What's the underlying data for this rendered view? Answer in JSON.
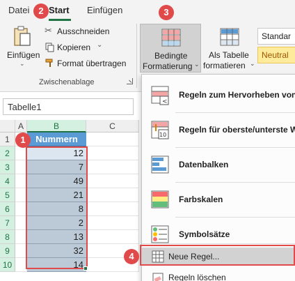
{
  "tabs": {
    "datei": "Datei",
    "start": "Start",
    "einfuegen": "Einfügen"
  },
  "ribbon": {
    "paste_label": "Einfügen",
    "cut_label": "Ausschneiden",
    "copy_label": "Kopieren",
    "format_painter_label": "Format übertragen",
    "clipboard_group_label": "Zwischenablage",
    "cond_format_line1": "Bedingte",
    "cond_format_line2": "Formatierung",
    "as_table_line1": "Als Tabelle",
    "as_table_line2": "formatieren",
    "style_standard": "Standar",
    "style_neutral": "Neutral"
  },
  "namebox": {
    "value": "Tabelle1"
  },
  "grid": {
    "columns": [
      "A",
      "B",
      "C"
    ],
    "header_row": "1",
    "header_cell": "Nummern",
    "rows": [
      {
        "row": "2",
        "value": "12"
      },
      {
        "row": "3",
        "value": "7"
      },
      {
        "row": "4",
        "value": "49"
      },
      {
        "row": "5",
        "value": "21"
      },
      {
        "row": "6",
        "value": "8"
      },
      {
        "row": "7",
        "value": "2"
      },
      {
        "row": "8",
        "value": "13"
      },
      {
        "row": "9",
        "value": "32"
      },
      {
        "row": "10",
        "value": "14"
      }
    ]
  },
  "menu": {
    "items": [
      {
        "label": "Regeln zum Hervorheben von",
        "icon": "highlight-rules-icon"
      },
      {
        "label": "Regeln für oberste/unterste W",
        "icon": "top-bottom-rules-icon"
      },
      {
        "label": "Datenbalken",
        "icon": "data-bars-icon"
      },
      {
        "label": "Farbskalen",
        "icon": "color-scales-icon"
      },
      {
        "label": "Symbolsätze",
        "icon": "icon-sets-icon"
      }
    ],
    "new_rule": "Neue Regel...",
    "clear_rules": "Regeln löschen"
  },
  "badges": {
    "b1": "1",
    "b2": "2",
    "b3": "3",
    "b4": "4"
  },
  "colors": {
    "accent": "#217346",
    "badge": "#e04a4a",
    "table_header": "#5b9bd5"
  }
}
